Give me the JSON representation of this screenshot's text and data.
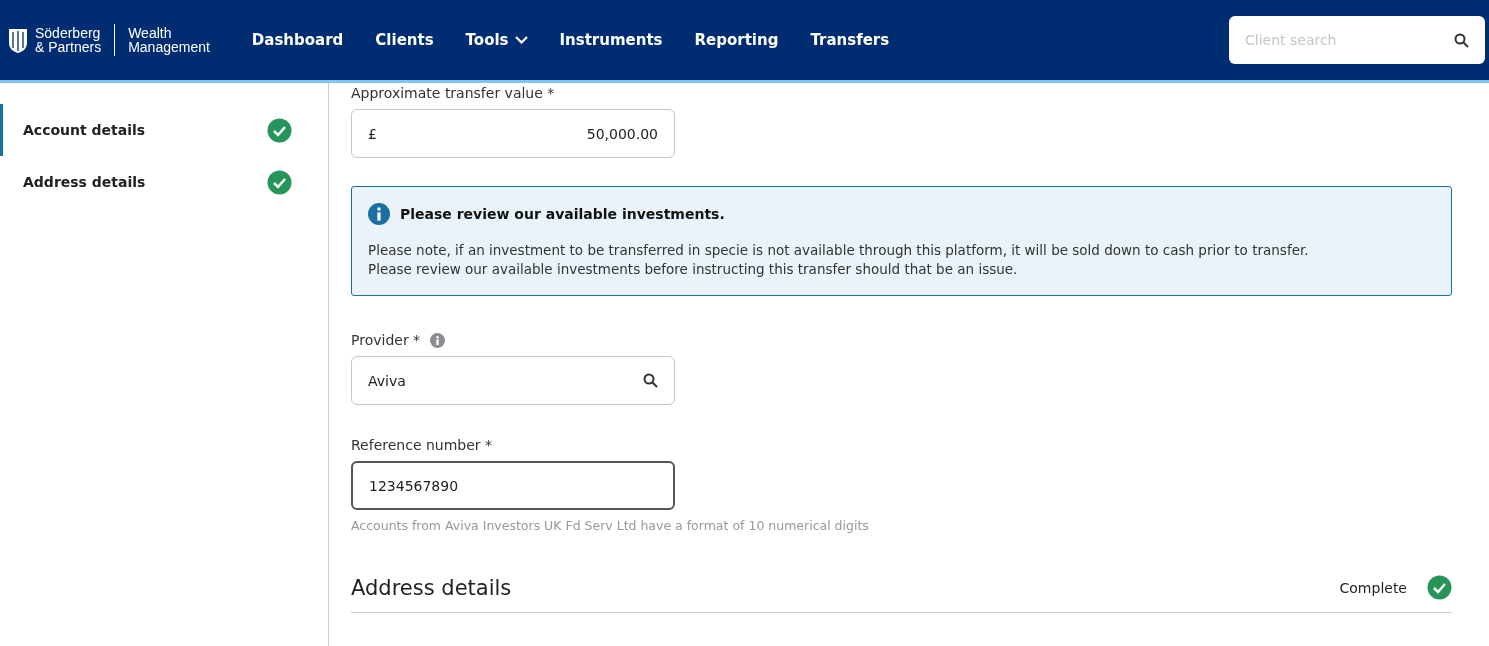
{
  "header": {
    "logo": {
      "brand_line_1": "Söderberg",
      "brand_line_2": "& Partners",
      "product_line_1": "Wealth",
      "product_line_2": "Management"
    },
    "nav": [
      {
        "label": "Dashboard",
        "kind": "link"
      },
      {
        "label": "Clients",
        "kind": "link"
      },
      {
        "label": "Tools",
        "kind": "menu"
      },
      {
        "label": "Instruments",
        "kind": "link"
      },
      {
        "label": "Reporting",
        "kind": "link"
      },
      {
        "label": "Transfers",
        "kind": "link"
      }
    ],
    "search": {
      "placeholder": "Client search"
    }
  },
  "sidebar": {
    "items": [
      {
        "label": "Account details",
        "selected": true,
        "complete": true
      },
      {
        "label": "Address details",
        "selected": false,
        "complete": true
      }
    ]
  },
  "form": {
    "transfer_value": {
      "label": "Approximate transfer value",
      "required_mark": "*",
      "prefix": "£",
      "value": "50,000.00",
      "focused": false
    },
    "notice": {
      "title": "Please review our available investments.",
      "lines": [
        "Please note, if an investment to be transferred in specie is not available through this platform, it will be sold down to cash prior to transfer.",
        "Please review our available investments before instructing this transfer should that be an issue."
      ]
    },
    "provider": {
      "label": "Provider",
      "required_mark": "*",
      "value": "Aviva",
      "focused": false
    },
    "reference": {
      "label": "Reference number",
      "required_mark": "*",
      "value": "1234567890",
      "focused": true,
      "hint": "Accounts from Aviva Investors UK Fd Serv Ltd have a format of 10 numerical digits"
    }
  },
  "section": {
    "title": "Address details",
    "status": "Complete",
    "complete": true
  }
}
